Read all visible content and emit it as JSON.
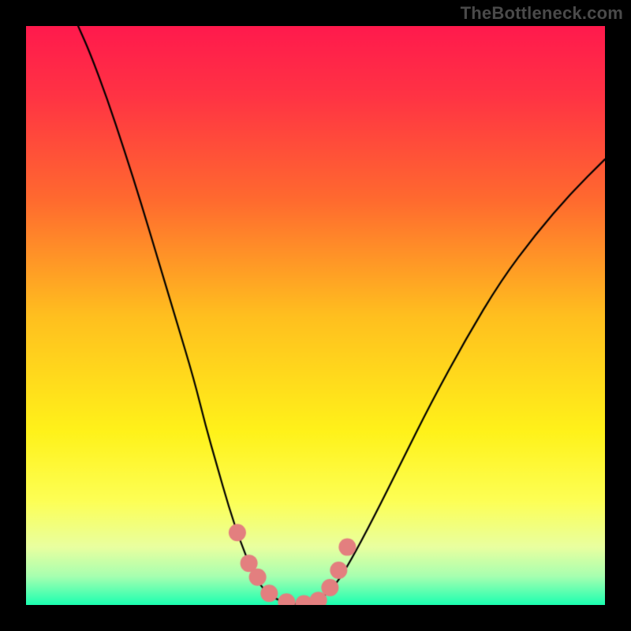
{
  "watermark": "TheBottleneck.com",
  "gradient": {
    "stops": [
      {
        "offset": 0.0,
        "color": "#ff1a4d"
      },
      {
        "offset": 0.12,
        "color": "#ff3344"
      },
      {
        "offset": 0.3,
        "color": "#ff6a2f"
      },
      {
        "offset": 0.5,
        "color": "#ffbf1f"
      },
      {
        "offset": 0.7,
        "color": "#fff21a"
      },
      {
        "offset": 0.82,
        "color": "#fdff55"
      },
      {
        "offset": 0.9,
        "color": "#e9ffa0"
      },
      {
        "offset": 0.95,
        "color": "#a8ffb0"
      },
      {
        "offset": 1.0,
        "color": "#1bffb0"
      }
    ]
  },
  "curve": {
    "stroke": "#000000",
    "width": 2.2,
    "points": [
      {
        "x": 0.09,
        "y": 1.0
      },
      {
        "x": 0.11,
        "y": 0.955
      },
      {
        "x": 0.14,
        "y": 0.875
      },
      {
        "x": 0.17,
        "y": 0.785
      },
      {
        "x": 0.2,
        "y": 0.69
      },
      {
        "x": 0.23,
        "y": 0.59
      },
      {
        "x": 0.26,
        "y": 0.49
      },
      {
        "x": 0.29,
        "y": 0.39
      },
      {
        "x": 0.31,
        "y": 0.31
      },
      {
        "x": 0.33,
        "y": 0.24
      },
      {
        "x": 0.35,
        "y": 0.17
      },
      {
        "x": 0.37,
        "y": 0.11
      },
      {
        "x": 0.39,
        "y": 0.06
      },
      {
        "x": 0.41,
        "y": 0.025
      },
      {
        "x": 0.44,
        "y": 0.005
      },
      {
        "x": 0.475,
        "y": 0.0
      },
      {
        "x": 0.51,
        "y": 0.01
      },
      {
        "x": 0.535,
        "y": 0.035
      },
      {
        "x": 0.56,
        "y": 0.075
      },
      {
        "x": 0.6,
        "y": 0.15
      },
      {
        "x": 0.65,
        "y": 0.25
      },
      {
        "x": 0.7,
        "y": 0.35
      },
      {
        "x": 0.76,
        "y": 0.46
      },
      {
        "x": 0.82,
        "y": 0.56
      },
      {
        "x": 0.88,
        "y": 0.64
      },
      {
        "x": 0.94,
        "y": 0.71
      },
      {
        "x": 1.0,
        "y": 0.77
      }
    ]
  },
  "markers": {
    "fill": "#e37f7f",
    "radius": 11,
    "points": [
      {
        "x": 0.365,
        "y": 0.125
      },
      {
        "x": 0.385,
        "y": 0.072
      },
      {
        "x": 0.4,
        "y": 0.048
      },
      {
        "x": 0.42,
        "y": 0.02
      },
      {
        "x": 0.45,
        "y": 0.005
      },
      {
        "x": 0.48,
        "y": 0.002
      },
      {
        "x": 0.505,
        "y": 0.008
      },
      {
        "x": 0.525,
        "y": 0.03
      },
      {
        "x": 0.54,
        "y": 0.06
      },
      {
        "x": 0.555,
        "y": 0.1
      }
    ]
  },
  "chart_data": {
    "type": "line",
    "title": "",
    "xlabel": "",
    "ylabel": "",
    "xlim": [
      0,
      1
    ],
    "ylim": [
      0,
      1
    ],
    "series": [
      {
        "name": "bottleneck-curve",
        "x": [
          0.09,
          0.11,
          0.14,
          0.17,
          0.2,
          0.23,
          0.26,
          0.29,
          0.31,
          0.33,
          0.35,
          0.37,
          0.39,
          0.41,
          0.44,
          0.475,
          0.51,
          0.535,
          0.56,
          0.6,
          0.65,
          0.7,
          0.76,
          0.82,
          0.88,
          0.94,
          1.0
        ],
        "y": [
          1.0,
          0.955,
          0.875,
          0.785,
          0.69,
          0.59,
          0.49,
          0.39,
          0.31,
          0.24,
          0.17,
          0.11,
          0.06,
          0.025,
          0.005,
          0.0,
          0.01,
          0.035,
          0.075,
          0.15,
          0.25,
          0.35,
          0.46,
          0.56,
          0.64,
          0.71,
          0.77
        ]
      },
      {
        "name": "highlighted-points",
        "x": [
          0.365,
          0.385,
          0.4,
          0.42,
          0.45,
          0.48,
          0.505,
          0.525,
          0.54,
          0.555
        ],
        "y": [
          0.125,
          0.072,
          0.048,
          0.02,
          0.005,
          0.002,
          0.008,
          0.03,
          0.06,
          0.1
        ]
      }
    ],
    "annotations": [
      {
        "text": "TheBottleneck.com",
        "position": "top-right"
      }
    ]
  }
}
